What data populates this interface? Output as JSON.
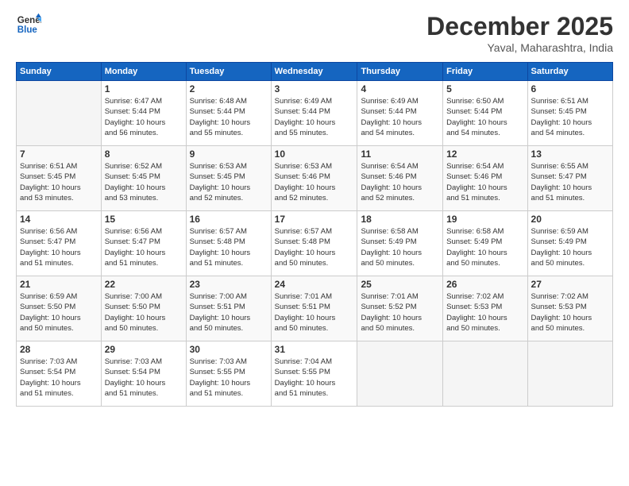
{
  "logo": {
    "line1": "General",
    "line2": "Blue"
  },
  "title": "December 2025",
  "location": "Yaval, Maharashtra, India",
  "weekdays": [
    "Sunday",
    "Monday",
    "Tuesday",
    "Wednesday",
    "Thursday",
    "Friday",
    "Saturday"
  ],
  "weeks": [
    [
      {
        "day": "",
        "info": ""
      },
      {
        "day": "1",
        "info": "Sunrise: 6:47 AM\nSunset: 5:44 PM\nDaylight: 10 hours\nand 56 minutes."
      },
      {
        "day": "2",
        "info": "Sunrise: 6:48 AM\nSunset: 5:44 PM\nDaylight: 10 hours\nand 55 minutes."
      },
      {
        "day": "3",
        "info": "Sunrise: 6:49 AM\nSunset: 5:44 PM\nDaylight: 10 hours\nand 55 minutes."
      },
      {
        "day": "4",
        "info": "Sunrise: 6:49 AM\nSunset: 5:44 PM\nDaylight: 10 hours\nand 54 minutes."
      },
      {
        "day": "5",
        "info": "Sunrise: 6:50 AM\nSunset: 5:44 PM\nDaylight: 10 hours\nand 54 minutes."
      },
      {
        "day": "6",
        "info": "Sunrise: 6:51 AM\nSunset: 5:45 PM\nDaylight: 10 hours\nand 54 minutes."
      }
    ],
    [
      {
        "day": "7",
        "info": "Sunrise: 6:51 AM\nSunset: 5:45 PM\nDaylight: 10 hours\nand 53 minutes."
      },
      {
        "day": "8",
        "info": "Sunrise: 6:52 AM\nSunset: 5:45 PM\nDaylight: 10 hours\nand 53 minutes."
      },
      {
        "day": "9",
        "info": "Sunrise: 6:53 AM\nSunset: 5:45 PM\nDaylight: 10 hours\nand 52 minutes."
      },
      {
        "day": "10",
        "info": "Sunrise: 6:53 AM\nSunset: 5:46 PM\nDaylight: 10 hours\nand 52 minutes."
      },
      {
        "day": "11",
        "info": "Sunrise: 6:54 AM\nSunset: 5:46 PM\nDaylight: 10 hours\nand 52 minutes."
      },
      {
        "day": "12",
        "info": "Sunrise: 6:54 AM\nSunset: 5:46 PM\nDaylight: 10 hours\nand 51 minutes."
      },
      {
        "day": "13",
        "info": "Sunrise: 6:55 AM\nSunset: 5:47 PM\nDaylight: 10 hours\nand 51 minutes."
      }
    ],
    [
      {
        "day": "14",
        "info": "Sunrise: 6:56 AM\nSunset: 5:47 PM\nDaylight: 10 hours\nand 51 minutes."
      },
      {
        "day": "15",
        "info": "Sunrise: 6:56 AM\nSunset: 5:47 PM\nDaylight: 10 hours\nand 51 minutes."
      },
      {
        "day": "16",
        "info": "Sunrise: 6:57 AM\nSunset: 5:48 PM\nDaylight: 10 hours\nand 51 minutes."
      },
      {
        "day": "17",
        "info": "Sunrise: 6:57 AM\nSunset: 5:48 PM\nDaylight: 10 hours\nand 50 minutes."
      },
      {
        "day": "18",
        "info": "Sunrise: 6:58 AM\nSunset: 5:49 PM\nDaylight: 10 hours\nand 50 minutes."
      },
      {
        "day": "19",
        "info": "Sunrise: 6:58 AM\nSunset: 5:49 PM\nDaylight: 10 hours\nand 50 minutes."
      },
      {
        "day": "20",
        "info": "Sunrise: 6:59 AM\nSunset: 5:49 PM\nDaylight: 10 hours\nand 50 minutes."
      }
    ],
    [
      {
        "day": "21",
        "info": "Sunrise: 6:59 AM\nSunset: 5:50 PM\nDaylight: 10 hours\nand 50 minutes."
      },
      {
        "day": "22",
        "info": "Sunrise: 7:00 AM\nSunset: 5:50 PM\nDaylight: 10 hours\nand 50 minutes."
      },
      {
        "day": "23",
        "info": "Sunrise: 7:00 AM\nSunset: 5:51 PM\nDaylight: 10 hours\nand 50 minutes."
      },
      {
        "day": "24",
        "info": "Sunrise: 7:01 AM\nSunset: 5:51 PM\nDaylight: 10 hours\nand 50 minutes."
      },
      {
        "day": "25",
        "info": "Sunrise: 7:01 AM\nSunset: 5:52 PM\nDaylight: 10 hours\nand 50 minutes."
      },
      {
        "day": "26",
        "info": "Sunrise: 7:02 AM\nSunset: 5:53 PM\nDaylight: 10 hours\nand 50 minutes."
      },
      {
        "day": "27",
        "info": "Sunrise: 7:02 AM\nSunset: 5:53 PM\nDaylight: 10 hours\nand 50 minutes."
      }
    ],
    [
      {
        "day": "28",
        "info": "Sunrise: 7:03 AM\nSunset: 5:54 PM\nDaylight: 10 hours\nand 51 minutes."
      },
      {
        "day": "29",
        "info": "Sunrise: 7:03 AM\nSunset: 5:54 PM\nDaylight: 10 hours\nand 51 minutes."
      },
      {
        "day": "30",
        "info": "Sunrise: 7:03 AM\nSunset: 5:55 PM\nDaylight: 10 hours\nand 51 minutes."
      },
      {
        "day": "31",
        "info": "Sunrise: 7:04 AM\nSunset: 5:55 PM\nDaylight: 10 hours\nand 51 minutes."
      },
      {
        "day": "",
        "info": ""
      },
      {
        "day": "",
        "info": ""
      },
      {
        "day": "",
        "info": ""
      }
    ]
  ]
}
